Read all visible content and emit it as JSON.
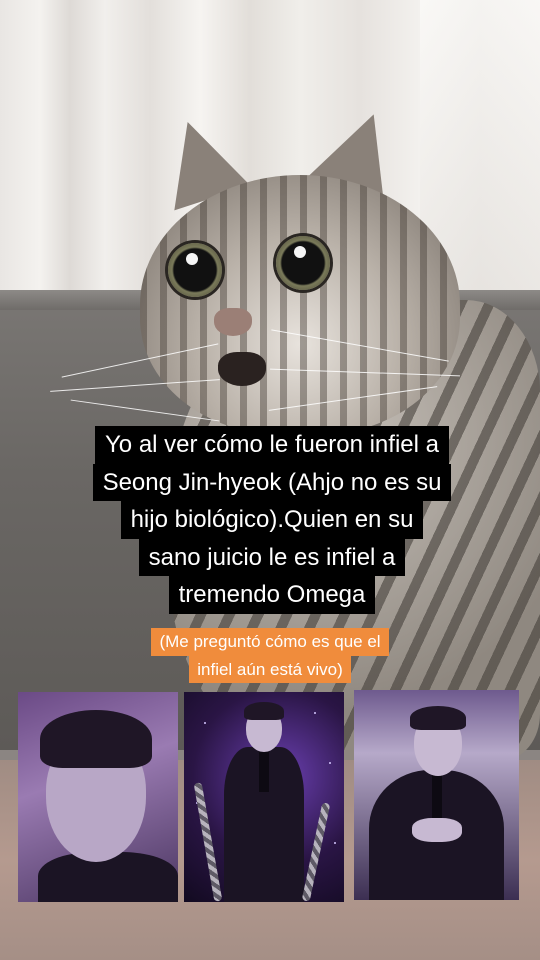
{
  "caption": {
    "lines": [
      "Yo al ver cómo le fueron infiel a",
      "Seong Jin-hyeok (Ahjo no es su",
      "hijo biológico).Quien en su",
      "sano juicio le es infiel a",
      "tremendo Omega"
    ]
  },
  "note": {
    "lines": [
      "(Me preguntó cómo es que el",
      "infiel aún está vivo)"
    ]
  },
  "colors": {
    "caption_bg": "#000000",
    "note_bg": "#f08c3c"
  }
}
